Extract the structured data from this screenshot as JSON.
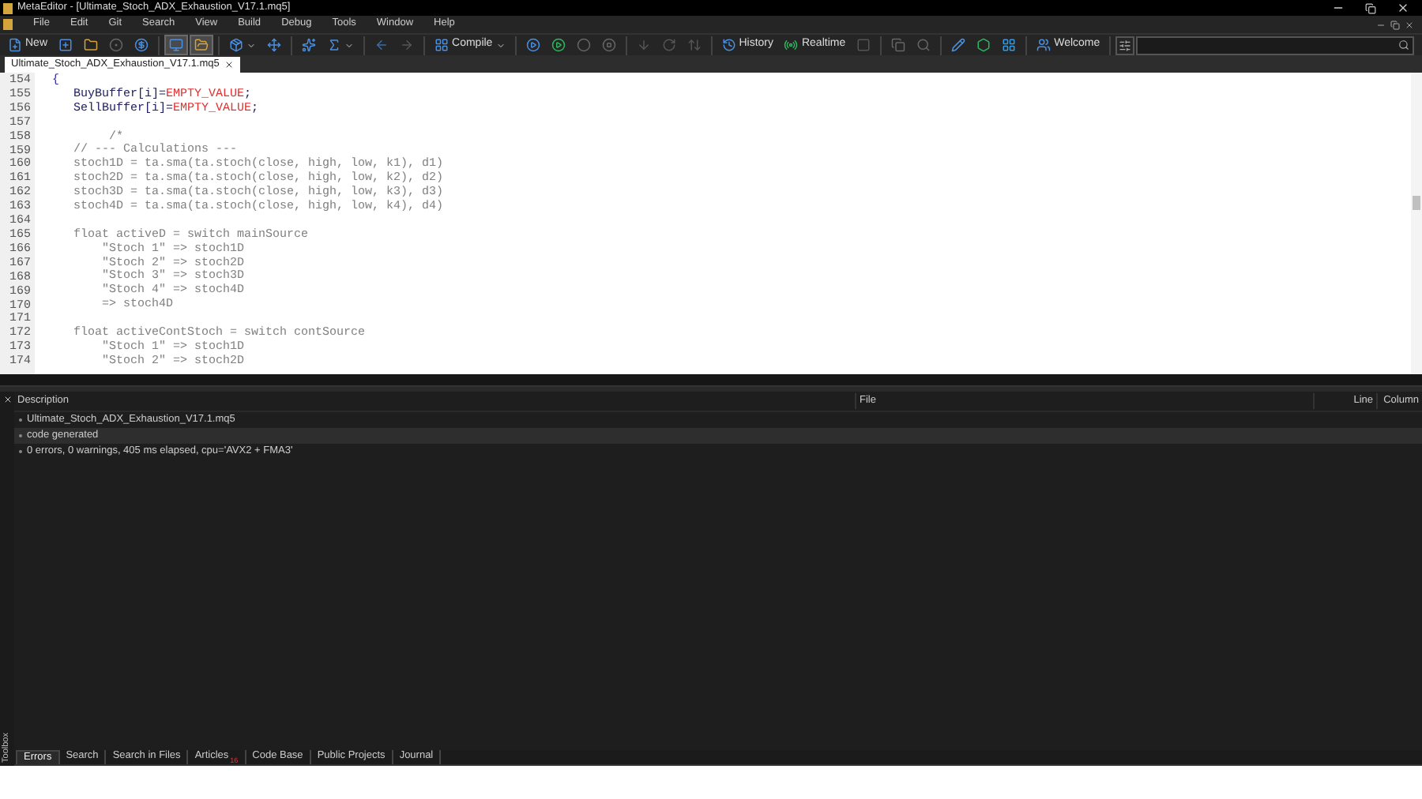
{
  "window": {
    "title": "MetaEditor - [Ultimate_Stoch_ADX_Exhaustion_V17.1.mq5]"
  },
  "menu": [
    "File",
    "Edit",
    "Git",
    "Search",
    "View",
    "Build",
    "Debug",
    "Tools",
    "Window",
    "Help"
  ],
  "toolbar": [
    {
      "kind": "button",
      "label": "New",
      "pressed": false
    },
    {
      "kind": "button",
      "pressed": false
    },
    {
      "kind": "button",
      "pressed": false
    },
    {
      "kind": "button",
      "pressed": false
    },
    {
      "kind": "button",
      "pressed": false
    },
    {
      "kind": "separator"
    },
    {
      "kind": "button",
      "pressed": true
    },
    {
      "kind": "button",
      "pressed": true
    },
    {
      "kind": "separator"
    },
    {
      "kind": "dropdown",
      "pressed": false
    },
    {
      "kind": "button",
      "pressed": false
    },
    {
      "kind": "separator"
    },
    {
      "kind": "button",
      "pressed": false
    },
    {
      "kind": "dropdown",
      "pressed": false
    },
    {
      "kind": "separator"
    },
    {
      "kind": "button",
      "pressed": false
    },
    {
      "kind": "button",
      "pressed": false
    },
    {
      "kind": "separator"
    },
    {
      "kind": "dropdown",
      "label": "Compile",
      "pressed": false
    },
    {
      "kind": "separator"
    },
    {
      "kind": "button",
      "pressed": false
    },
    {
      "kind": "button",
      "pressed": false
    },
    {
      "kind": "button",
      "pressed": false
    },
    {
      "kind": "button",
      "pressed": false
    },
    {
      "kind": "separator"
    },
    {
      "kind": "button",
      "pressed": false
    },
    {
      "kind": "button",
      "pressed": false
    },
    {
      "kind": "button",
      "pressed": false
    },
    {
      "kind": "separator"
    },
    {
      "kind": "button",
      "label": "History",
      "pressed": false
    },
    {
      "kind": "button",
      "label": "Realtime",
      "pressed": false
    },
    {
      "kind": "button",
      "pressed": false
    },
    {
      "kind": "separator"
    },
    {
      "kind": "button",
      "pressed": false
    },
    {
      "kind": "button",
      "pressed": false
    },
    {
      "kind": "separator"
    },
    {
      "kind": "button",
      "pressed": false
    },
    {
      "kind": "button",
      "pressed": false
    },
    {
      "kind": "button",
      "pressed": false
    },
    {
      "kind": "separator"
    },
    {
      "kind": "button",
      "label": "Welcome",
      "pressed": false
    }
  ],
  "editor_tabs": [
    {
      "label": "Ultimate_Stoch_ADX_Exhaustion_V17.1.mq5",
      "selected": true
    }
  ],
  "code_lines": [
    {
      "number": "154",
      "segments": [
        {
          "kind": "brace",
          "text": "{"
        }
      ]
    },
    {
      "number": "155",
      "segments": [
        {
          "kind": "name",
          "text": "   BuyBuffer[i]="
        },
        {
          "kind": "constant",
          "text": "EMPTY_VALUE"
        },
        {
          "kind": "name",
          "text": ";"
        }
      ]
    },
    {
      "number": "156",
      "segments": [
        {
          "kind": "name",
          "text": "   SellBuffer[i]="
        },
        {
          "kind": "constant",
          "text": "EMPTY_VALUE"
        },
        {
          "kind": "name",
          "text": ";"
        }
      ]
    },
    {
      "number": "157"
    },
    {
      "number": "158",
      "segments": [
        {
          "kind": "plain",
          "text": "        /*"
        }
      ]
    },
    {
      "number": "159",
      "segments": [
        {
          "kind": "plain",
          "text": "   // --- Calculations ---"
        }
      ]
    },
    {
      "number": "160",
      "segments": [
        {
          "kind": "plain",
          "text": "   stoch1D = ta.sma(ta.stoch(close, high, low, k1), d1)"
        }
      ]
    },
    {
      "number": "161",
      "segments": [
        {
          "kind": "plain",
          "text": "   stoch2D = ta.sma(ta.stoch(close, high, low, k2), d2)"
        }
      ]
    },
    {
      "number": "162",
      "segments": [
        {
          "kind": "plain",
          "text": "   stoch3D = ta.sma(ta.stoch(close, high, low, k3), d3)"
        }
      ]
    },
    {
      "number": "163",
      "segments": [
        {
          "kind": "plain",
          "text": "   stoch4D = ta.sma(ta.stoch(close, high, low, k4), d4)"
        }
      ]
    },
    {
      "number": "164"
    },
    {
      "number": "165",
      "segments": [
        {
          "kind": "plain",
          "text": "   float activeD = switch mainSource"
        }
      ]
    },
    {
      "number": "166",
      "segments": [
        {
          "kind": "plain",
          "text": "       \"Stoch 1\" => stoch1D"
        }
      ]
    },
    {
      "number": "167",
      "segments": [
        {
          "kind": "plain",
          "text": "       \"Stoch 2\" => stoch2D"
        }
      ]
    },
    {
      "number": "168",
      "segments": [
        {
          "kind": "plain",
          "text": "       \"Stoch 3\" => stoch3D"
        }
      ]
    },
    {
      "number": "169",
      "segments": [
        {
          "kind": "plain",
          "text": "       \"Stoch 4\" => stoch4D"
        }
      ]
    },
    {
      "number": "170",
      "segments": [
        {
          "kind": "plain",
          "text": "       => stoch4D"
        }
      ]
    },
    {
      "number": "171"
    },
    {
      "number": "172",
      "segments": [
        {
          "kind": "plain",
          "text": "   float activeContStoch = switch contSource"
        }
      ]
    },
    {
      "number": "173",
      "segments": [
        {
          "kind": "plain",
          "text": "       \"Stoch 1\" => stoch1D"
        }
      ]
    },
    {
      "number": "174",
      "segments": [
        {
          "kind": "plain",
          "text": "       \"Stoch 2\" => stoch2D"
        }
      ]
    }
  ],
  "errors_panel": {
    "columns": [
      "Description",
      "File",
      "Line",
      "Column"
    ],
    "rows": [
      {
        "text": "Ultimate_Stoch_ADX_Exhaustion_V17.1.mq5",
        "selected": false
      },
      {
        "text": "code generated",
        "selected": true
      },
      {
        "text": "0 errors, 0 warnings, 405 ms elapsed, cpu='AVX2 + FMA3'",
        "selected": false
      }
    ]
  },
  "toolbox_label": "Toolbox",
  "bottom_tabs": [
    {
      "label": "Errors",
      "selected": true
    },
    {
      "label": "Search",
      "selected": false
    },
    {
      "label": "Search in Files",
      "selected": false
    },
    {
      "label": "Articles",
      "badge": "16",
      "selected": false
    },
    {
      "label": "Code Base",
      "selected": false
    },
    {
      "label": "Public Projects",
      "selected": false
    },
    {
      "label": "Journal",
      "selected": false
    }
  ]
}
